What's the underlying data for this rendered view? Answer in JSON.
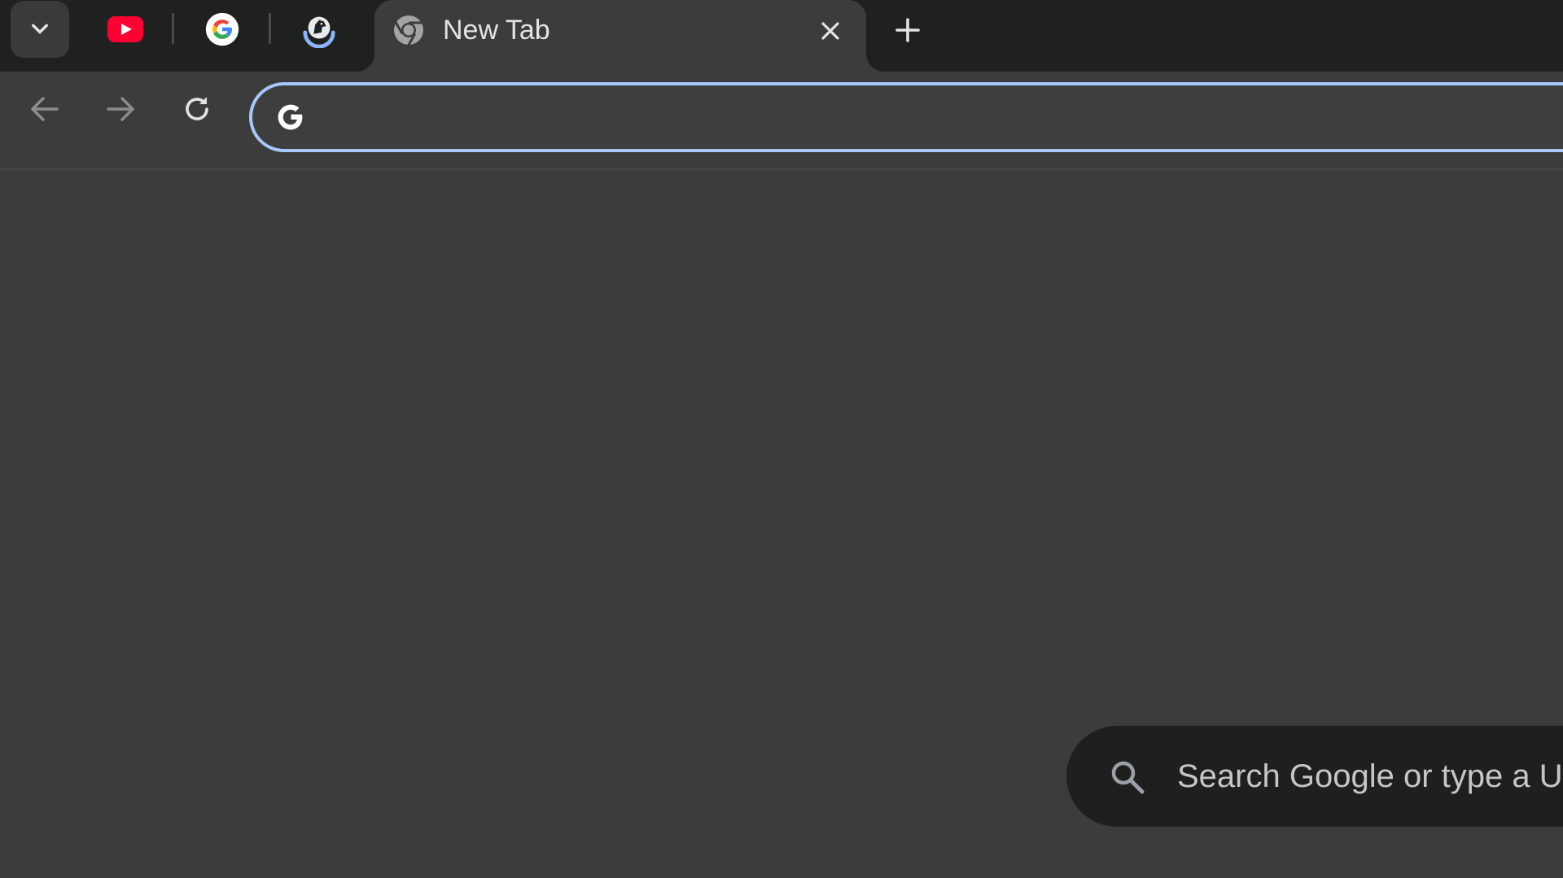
{
  "tab_strip": {
    "tab_search_icon": "chevron-down-icon",
    "pinned_tabs": [
      {
        "icon": "youtube-icon"
      },
      {
        "icon": "google-icon"
      },
      {
        "icon": "horse-logo-icon"
      }
    ],
    "active_tab": {
      "title": "New Tab",
      "favicon": "chrome-icon"
    },
    "new_tab_icon": "plus-icon"
  },
  "toolbar": {
    "back_icon": "arrow-left-icon",
    "forward_icon": "arrow-right-icon",
    "reload_icon": "reload-icon",
    "omnibox": {
      "value": "",
      "icon": "google-g-icon"
    }
  },
  "ntp": {
    "search_placeholder": "Search Google or type a U",
    "search_icon": "search-icon"
  },
  "colors": {
    "frame": "#1f2020",
    "toolbar": "#3c3c3c",
    "omnibox_border": "#a8c7fa",
    "ntp_search_bg": "#1f1f1f",
    "youtube_red": "#ff0033"
  }
}
